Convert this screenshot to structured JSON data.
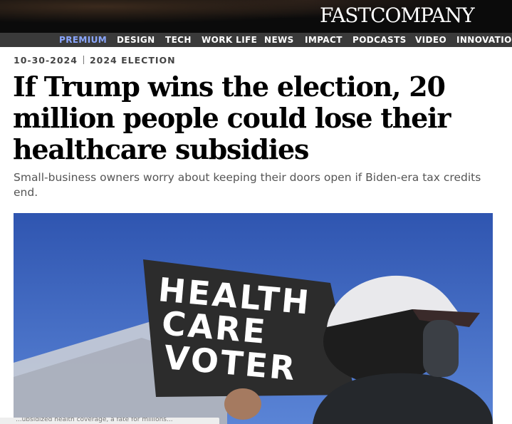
{
  "brand": {
    "logo_text": "FASTCOMPANY"
  },
  "nav": {
    "items": [
      {
        "label": "PREMIUM"
      },
      {
        "label": "DESIGN"
      },
      {
        "label": "TECH"
      },
      {
        "label": "WORK LIFE"
      },
      {
        "label": "NEWS"
      },
      {
        "label": "IMPACT"
      },
      {
        "label": "PODCASTS"
      },
      {
        "label": "VIDEO"
      },
      {
        "label": "INNOVATIO"
      }
    ]
  },
  "article": {
    "date": "10-30-2024",
    "category": "2024 ELECTION",
    "headline": "If Trump wins the election, 20 million people could lose their healthcare subsidies",
    "dek": "Small-business owners worry about keeping their doors open if Biden-era tax credits end.",
    "image": {
      "sign_lines": [
        "HEALTH",
        "CARE",
        "VOTER"
      ]
    },
    "caption_partial": "...ubsidized health coverage, a fate for millions..."
  },
  "colors": {
    "topbar": "#0b0b0b",
    "nav_bg": "#3a3a3a",
    "premium_accent": "#8aa6ff",
    "sky": "#3a5fb8"
  }
}
